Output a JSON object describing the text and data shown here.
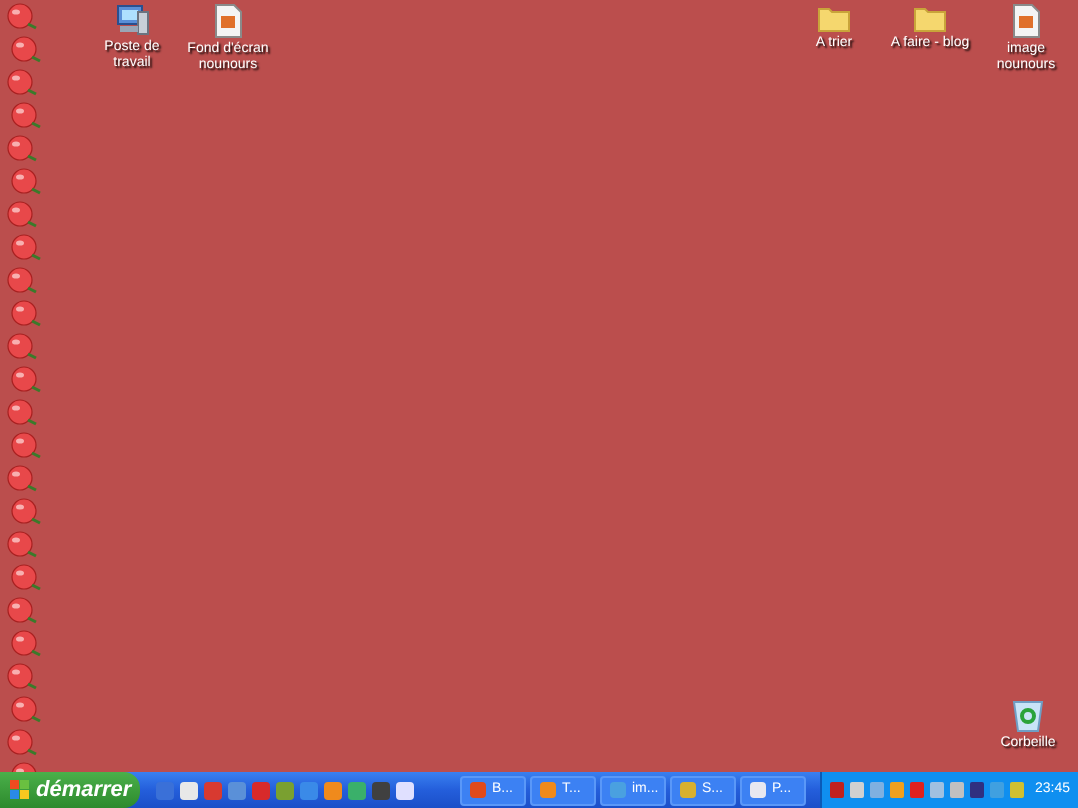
{
  "desktop": {
    "left_icons": [
      {
        "label": "Poste de travail",
        "kind": "computer"
      },
      {
        "label": "Fond d'écran nounours",
        "kind": "document"
      }
    ],
    "right_icons": [
      {
        "label": "A trier",
        "kind": "folder"
      },
      {
        "label": "A faire - blog",
        "kind": "folder"
      },
      {
        "label": "image nounours",
        "kind": "document"
      }
    ],
    "bottom_icons": [
      {
        "label": "Corbeille",
        "kind": "recycle"
      }
    ]
  },
  "taskbar": {
    "start_button": "démarrer",
    "task_buttons": [
      {
        "label": "B...",
        "kind": "messenger"
      },
      {
        "label": "T...",
        "kind": "browser"
      },
      {
        "label": "im...",
        "kind": "image"
      },
      {
        "label": "S...",
        "kind": "paint"
      },
      {
        "label": "P...",
        "kind": "document"
      }
    ],
    "clock": "23:45"
  }
}
